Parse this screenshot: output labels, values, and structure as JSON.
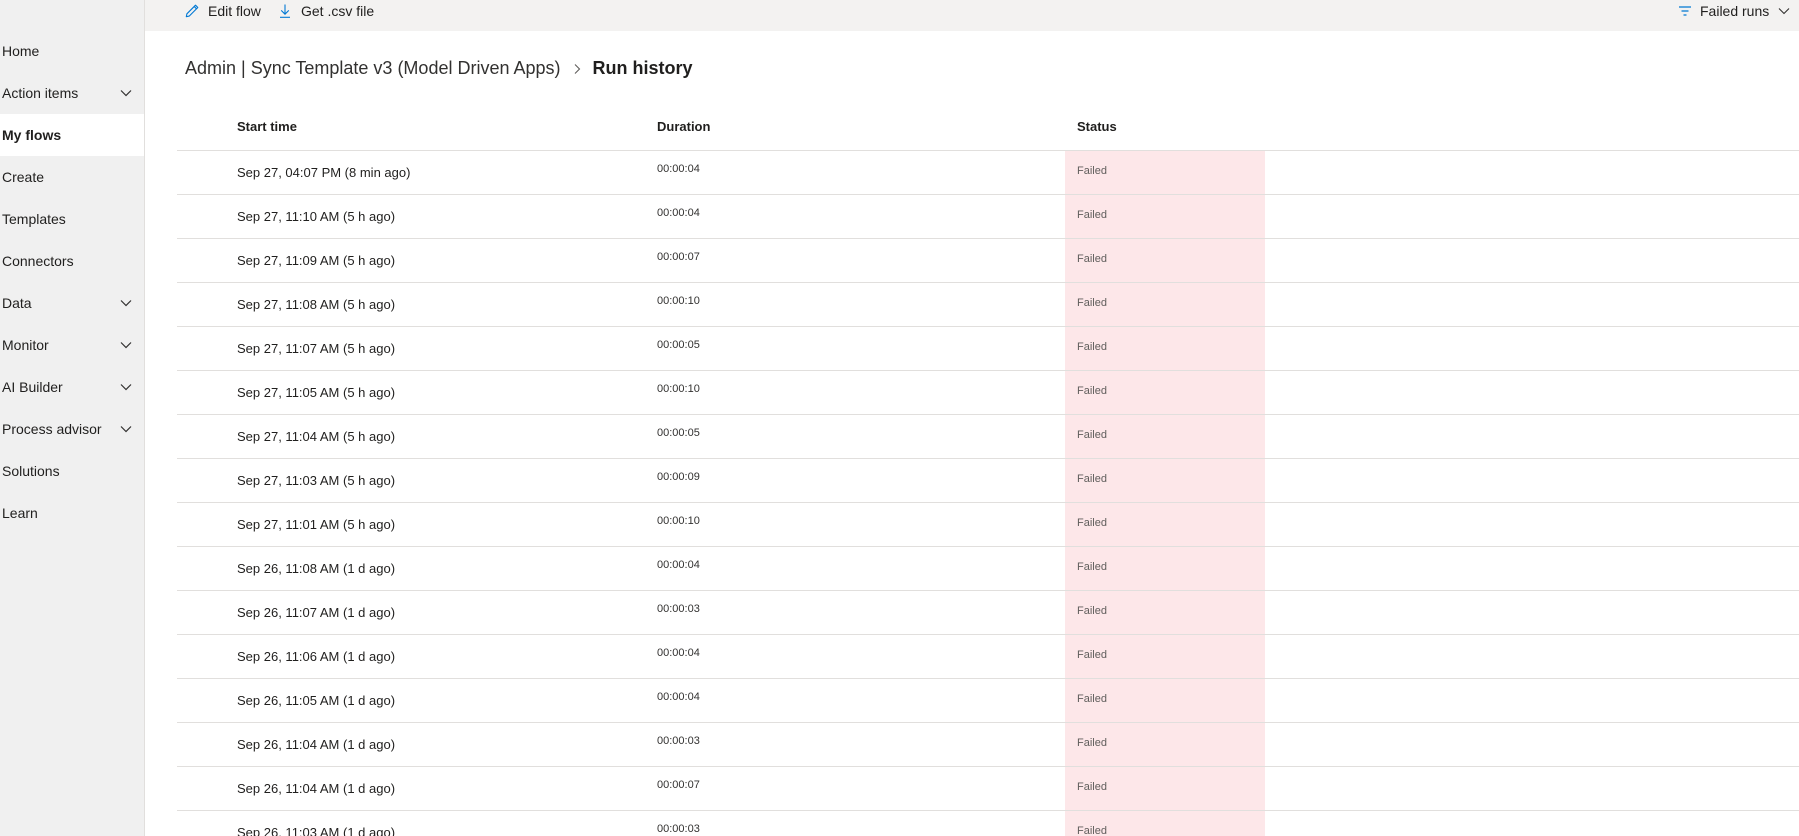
{
  "sidebar": {
    "items": [
      {
        "label": "Home",
        "chevron": false,
        "active": false
      },
      {
        "label": "Action items",
        "chevron": true,
        "active": false
      },
      {
        "label": "My flows",
        "chevron": false,
        "active": true
      },
      {
        "label": "Create",
        "chevron": false,
        "active": false
      },
      {
        "label": "Templates",
        "chevron": false,
        "active": false
      },
      {
        "label": "Connectors",
        "chevron": false,
        "active": false
      },
      {
        "label": "Data",
        "chevron": true,
        "active": false
      },
      {
        "label": "Monitor",
        "chevron": true,
        "active": false
      },
      {
        "label": "AI Builder",
        "chevron": true,
        "active": false
      },
      {
        "label": "Process advisor",
        "chevron": true,
        "active": false
      },
      {
        "label": "Solutions",
        "chevron": false,
        "active": false
      },
      {
        "label": "Learn",
        "chevron": false,
        "active": false
      }
    ]
  },
  "toolbar": {
    "edit_flow": "Edit flow",
    "get_csv": "Get .csv file",
    "filter": "Failed runs",
    "icons": {
      "edit": "pencil-icon",
      "download": "download-icon",
      "filter": "filter-icon",
      "chevron": "chevron-down-icon"
    }
  },
  "breadcrumb": {
    "parent": "Admin | Sync Template v3 (Model Driven Apps)",
    "current": "Run history"
  },
  "table": {
    "columns": [
      "Start time",
      "Duration",
      "Status"
    ],
    "rows": [
      {
        "start": "Sep 27, 04:07 PM (8 min ago)",
        "duration": "00:00:04",
        "status": "Failed"
      },
      {
        "start": "Sep 27, 11:10 AM (5 h ago)",
        "duration": "00:00:04",
        "status": "Failed"
      },
      {
        "start": "Sep 27, 11:09 AM (5 h ago)",
        "duration": "00:00:07",
        "status": "Failed"
      },
      {
        "start": "Sep 27, 11:08 AM (5 h ago)",
        "duration": "00:00:10",
        "status": "Failed"
      },
      {
        "start": "Sep 27, 11:07 AM (5 h ago)",
        "duration": "00:00:05",
        "status": "Failed"
      },
      {
        "start": "Sep 27, 11:05 AM (5 h ago)",
        "duration": "00:00:10",
        "status": "Failed"
      },
      {
        "start": "Sep 27, 11:04 AM (5 h ago)",
        "duration": "00:00:05",
        "status": "Failed"
      },
      {
        "start": "Sep 27, 11:03 AM (5 h ago)",
        "duration": "00:00:09",
        "status": "Failed"
      },
      {
        "start": "Sep 27, 11:01 AM (5 h ago)",
        "duration": "00:00:10",
        "status": "Failed"
      },
      {
        "start": "Sep 26, 11:08 AM (1 d ago)",
        "duration": "00:00:04",
        "status": "Failed"
      },
      {
        "start": "Sep 26, 11:07 AM (1 d ago)",
        "duration": "00:00:03",
        "status": "Failed"
      },
      {
        "start": "Sep 26, 11:06 AM (1 d ago)",
        "duration": "00:00:04",
        "status": "Failed"
      },
      {
        "start": "Sep 26, 11:05 AM (1 d ago)",
        "duration": "00:00:04",
        "status": "Failed"
      },
      {
        "start": "Sep 26, 11:04 AM (1 d ago)",
        "duration": "00:00:03",
        "status": "Failed"
      },
      {
        "start": "Sep 26, 11:04 AM (1 d ago)",
        "duration": "00:00:07",
        "status": "Failed"
      },
      {
        "start": "Sep 26, 11:03 AM (1 d ago)",
        "duration": "00:00:03",
        "status": "Failed"
      }
    ]
  },
  "colors": {
    "failed_bg": "#fde7e9",
    "accent": "#0078d4",
    "sidebar_bg": "#f0f0f0"
  }
}
